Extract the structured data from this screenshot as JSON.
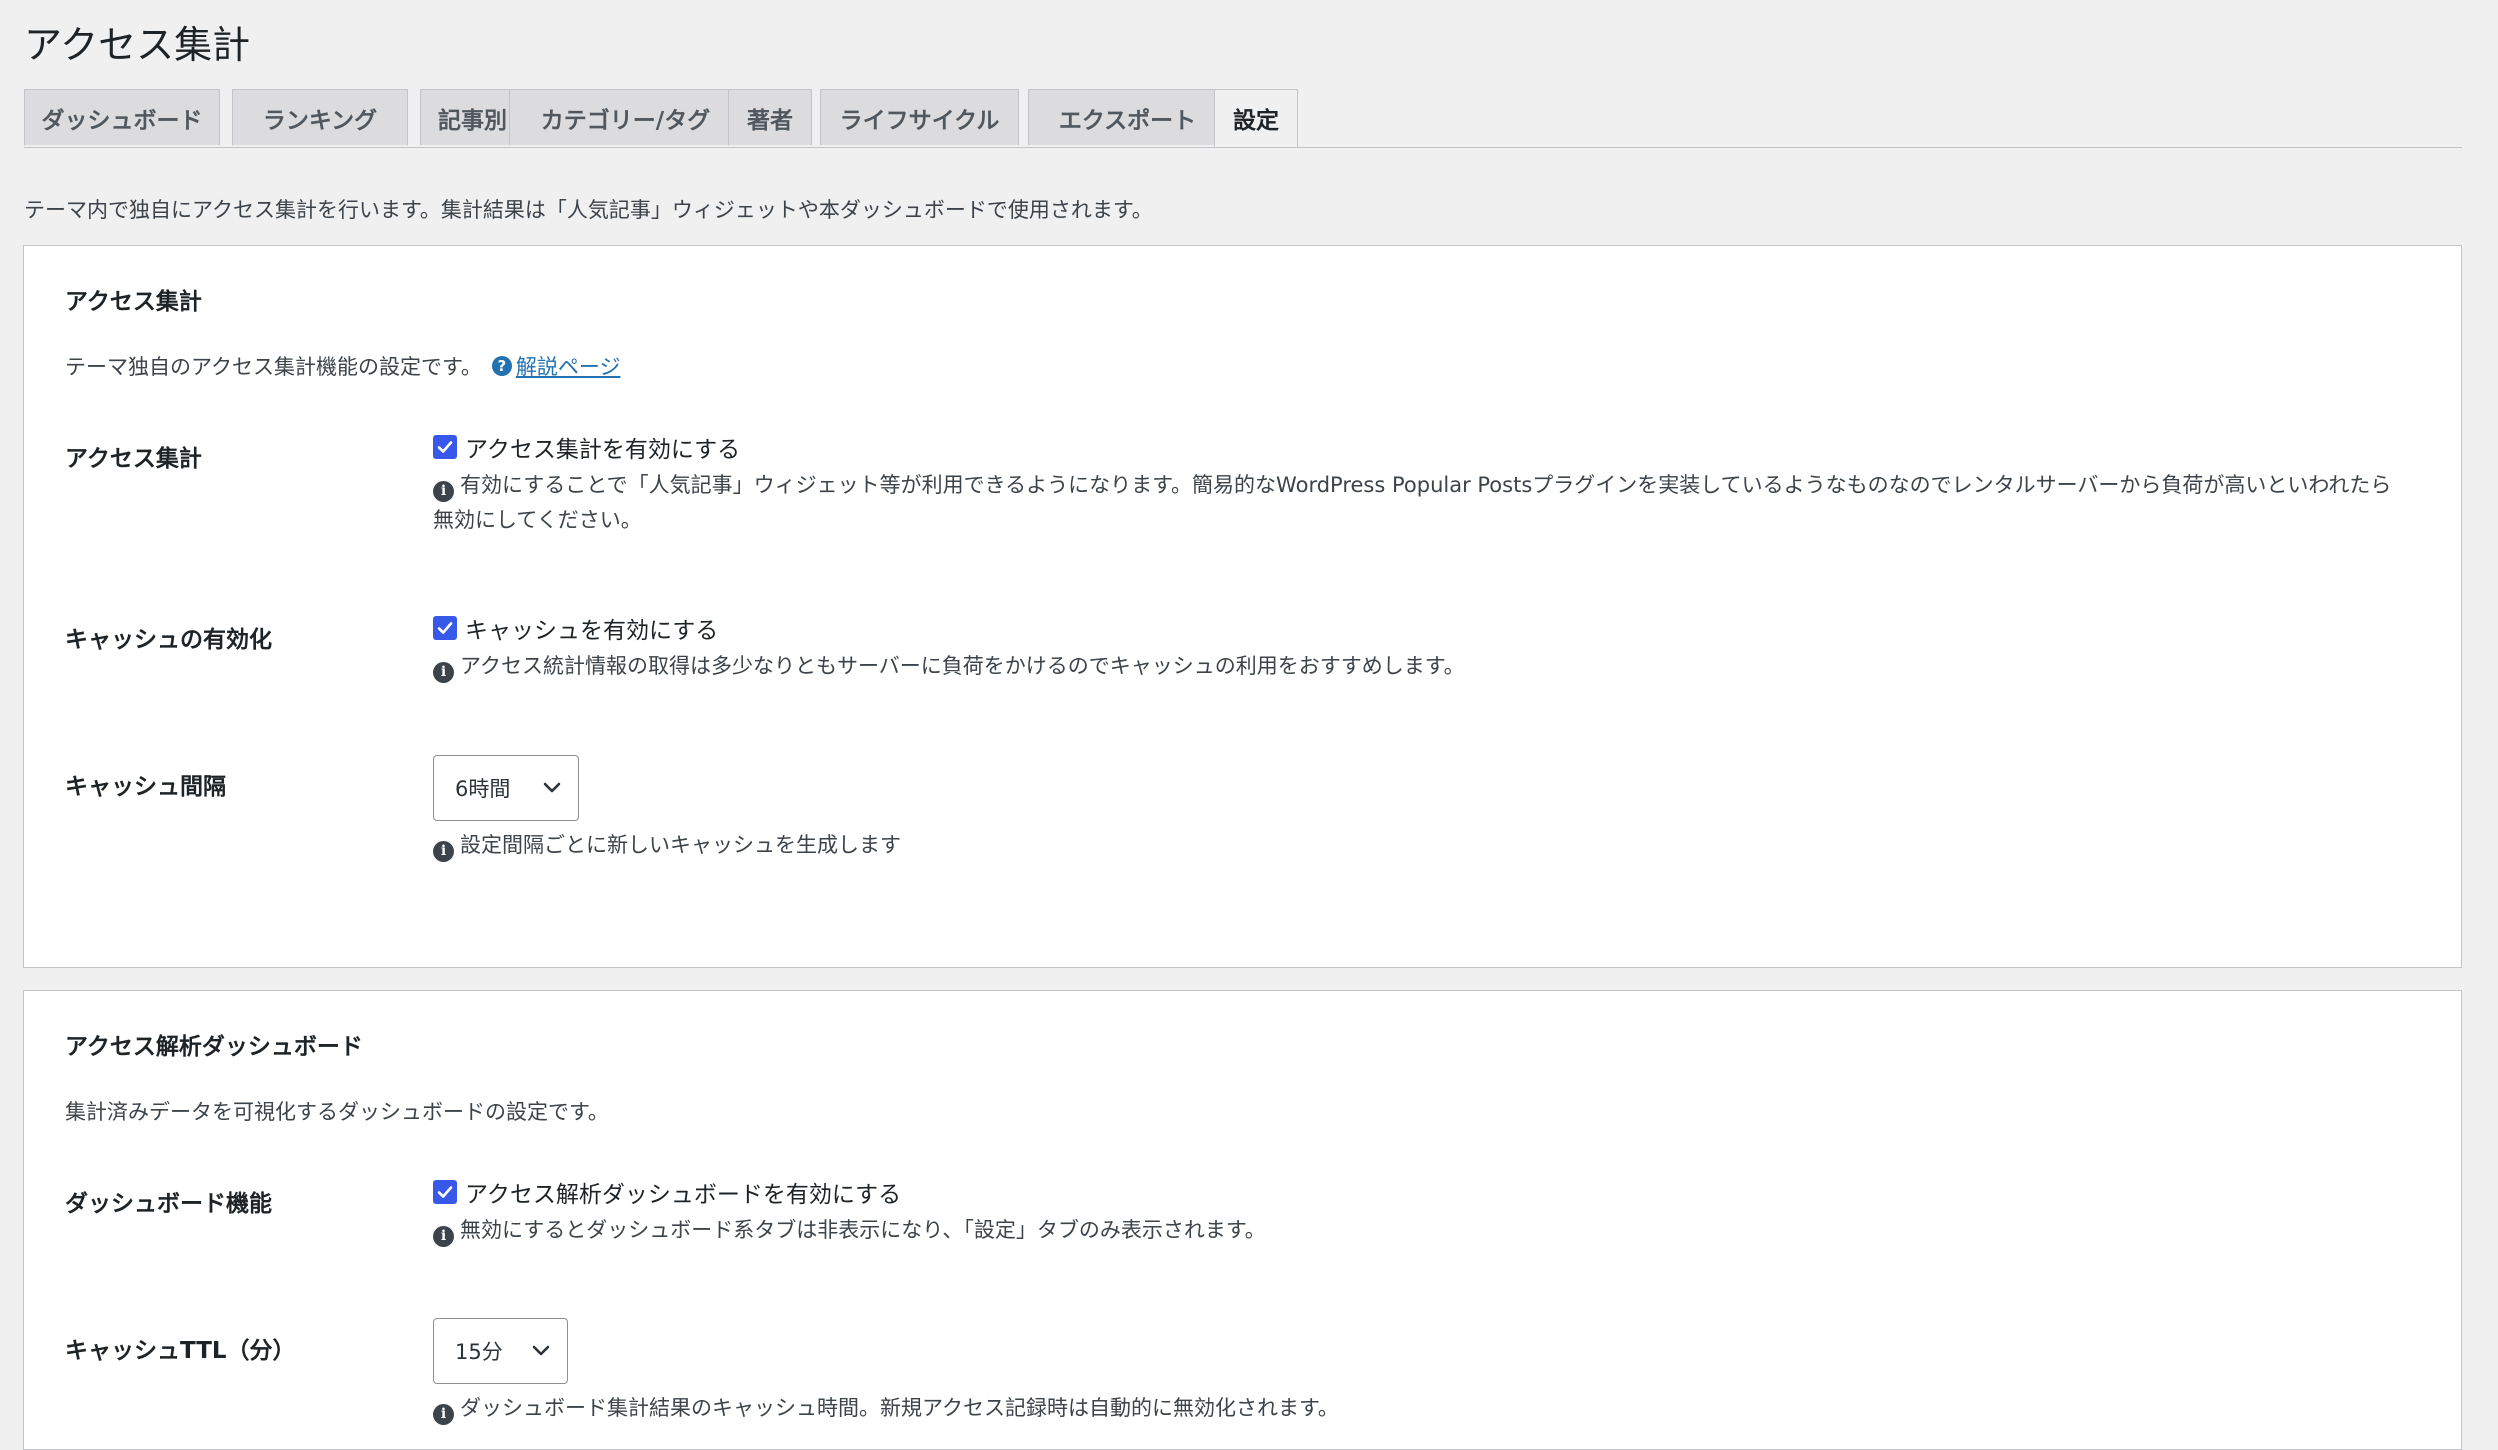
{
  "page": {
    "title": "アクセス集計",
    "intro": "テーマ内で独自にアクセス集計を行います。集計結果は「人気記事」ウィジェットや本ダッシュボードで使用されます。"
  },
  "tabs": [
    {
      "label": "ダッシュボード",
      "active": false
    },
    {
      "label": "ランキング",
      "active": false
    },
    {
      "label": "記事別",
      "active": false
    },
    {
      "label": "カテゴリー/タグ",
      "active": false
    },
    {
      "label": "著者",
      "active": false
    },
    {
      "label": "ライフサイクル",
      "active": false
    },
    {
      "label": "エクスポート",
      "active": false
    },
    {
      "label": "設定",
      "active": true
    }
  ],
  "section_access": {
    "title": "アクセス集計",
    "desc": "テーマ独自のアクセス集計機能の設定です。",
    "help_link": "解説ページ",
    "rows": {
      "enable": {
        "label": "アクセス集計",
        "checkbox_label": "アクセス集計を有効にする",
        "checked": true,
        "note": "有効にすることで「人気記事」ウィジェット等が利用できるようになります。簡易的なWordPress Popular Postsプラグインを実装しているようなものなのでレンタルサーバーから負荷が高いといわれたら無効にしてください。"
      },
      "cache": {
        "label": "キャッシュの有効化",
        "checkbox_label": "キャッシュを有効にする",
        "checked": true,
        "note": "アクセス統計情報の取得は多少なりともサーバーに負荷をかけるのでキャッシュの利用をおすすめします。"
      },
      "interval": {
        "label": "キャッシュ間隔",
        "select_value": "6時間",
        "note": "設定間隔ごとに新しいキャッシュを生成します"
      }
    }
  },
  "section_dashboard": {
    "title": "アクセス解析ダッシュボード",
    "desc": "集計済みデータを可視化するダッシュボードの設定です。",
    "rows": {
      "feature": {
        "label": "ダッシュボード機能",
        "checkbox_label": "アクセス解析ダッシュボードを有効にする",
        "checked": true,
        "note": "無効にするとダッシュボード系タブは非表示になり、「設定」タブのみ表示されます。"
      },
      "ttl": {
        "label": "キャッシュTTL（分）",
        "select_value": "15分",
        "note": "ダッシュボード集計結果のキャッシュ時間。新規アクセス記録時は自動的に無効化されます。"
      }
    }
  },
  "colors": {
    "checkbox": "#3858e9",
    "link": "#2271b1",
    "background": "#f0f0f1"
  },
  "icons": {
    "help": "question-circle-icon",
    "info": "info-circle-icon",
    "check": "checkmark-icon",
    "select": "chevron-down-icon"
  }
}
